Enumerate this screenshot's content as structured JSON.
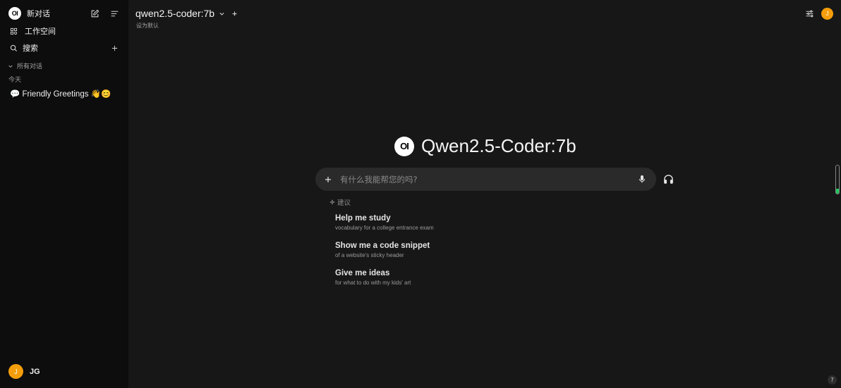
{
  "sidebar": {
    "logo_text": "OI",
    "new_chat": "新对话",
    "workspace": "工作空间",
    "search": "搜索",
    "all_chats": "所有对话",
    "today": "今天",
    "chats": [
      {
        "title": "💬 Friendly Greetings 👋😊"
      }
    ],
    "user": {
      "initial": "J",
      "name": "JG"
    }
  },
  "header": {
    "model": "qwen2.5-coder:7b",
    "set_default": "设为默认",
    "user_initial": "J"
  },
  "hero": {
    "logo_text": "OI",
    "title": "Qwen2.5-Coder:7b"
  },
  "input": {
    "placeholder": "有什么我能帮您的吗?"
  },
  "suggestions": {
    "label": "建议",
    "items": [
      {
        "title": "Help me study",
        "subtitle": "vocabulary for a college entrance exam"
      },
      {
        "title": "Show me a code snippet",
        "subtitle": "of a website's sticky header"
      },
      {
        "title": "Give me ideas",
        "subtitle": "for what to do with my kids' art"
      }
    ]
  },
  "help": "?",
  "colors": {
    "accent_avatar": "#f59e0b",
    "indicator": "#22c55e"
  },
  "voice_level": 0.18
}
